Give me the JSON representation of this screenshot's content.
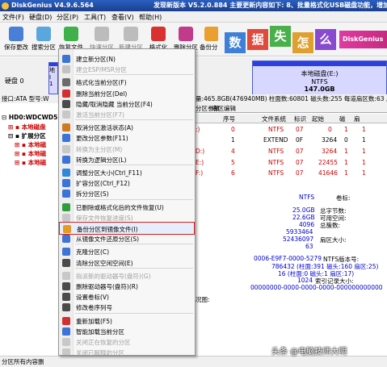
{
  "window": {
    "title": "DiskGenius V4.9.6.564",
    "notice": "发现新版本 V5.2.0.884 主要更新内容如下: 8、批量格式化USB磁盘功能，增加ext4分"
  },
  "menu": [
    "文件(F)",
    "硬盘(D)",
    "分区(P)",
    "工具(T)",
    "查看(V)",
    "帮助(H)"
  ],
  "toolbar": [
    "保存更改",
    "搜索分区",
    "恢复文件",
    "快速分区",
    "新建分区",
    "格式化",
    "删除分区",
    "备份分区"
  ],
  "banner": {
    "chars": [
      "数",
      "据",
      "失",
      "怎",
      "么",
      "办"
    ],
    "brand": "DiskGenius"
  },
  "disk": {
    "label": "硬盘 0",
    "part_name": "本地磁盘(E:)",
    "part_fs": "NTFS",
    "part_size": "147.0GB"
  },
  "left_fragments": [
    "地",
    "I",
    "1"
  ],
  "infobar": {
    "left": "接口:ATA  型号:W",
    "right": "区数:255  每道扇区数:63  总扇"
  },
  "infobar_mid": "量:465.8GB(476940MB)  柱面数:60801  磁头数:255  每道扇区数:63  总扇",
  "tree": {
    "root": "HD0:WDCWD5",
    "items": [
      "本地磁盘",
      "扩展分区",
      "本地磁",
      "本地磁",
      "本地磁"
    ]
  },
  "tabs": [
    "分区参数",
    "浏览文件",
    "扇区编辑"
  ],
  "table": {
    "headers": [
      "序号",
      "文件系统",
      "标识",
      "起始",
      "磁",
      "扇"
    ],
    "rows": [
      [
        "0",
        "NTFS",
        "07",
        "0",
        "1",
        "1"
      ],
      [
        "1",
        "EXTEND",
        "0F",
        "3264",
        "0",
        "1"
      ],
      [
        "4",
        "NTFS",
        "07",
        "3264",
        "1",
        "1"
      ],
      [
        "5",
        "NTFS",
        "07",
        "22455",
        "1",
        "1"
      ],
      [
        "6",
        "NTFS",
        "07",
        "41646",
        "1",
        "1"
      ]
    ],
    "row_suffix": [
      ":)",
      "",
      "D:)",
      "E:)",
      "F:)"
    ]
  },
  "details": {
    "fs": "NTFS",
    "fs_label": "卷标:",
    "values": [
      "25.0GB",
      "22.6GB",
      "4096",
      "5933464",
      "52436097",
      "63"
    ],
    "labels": [
      "总字节数:",
      "可用空间:",
      "总簇数:",
      "扇区大小:",
      ""
    ],
    "extra": [
      "0006-E9F7-0000-5279",
      "786432 (柱面:391 磁头:160 扇区:25)",
      "16 (柱面:0 磁头:1 扇区:17)",
      "1024",
      "00000000-0000-0000-0000-000000000000"
    ],
    "extra_labels": [
      "NTFS版本号:",
      "",
      "",
      "索引记录大小:",
      ""
    ],
    "chart_label": "况图:"
  },
  "context_menu": {
    "items": [
      {
        "label": "建立新分区(N)",
        "enabled": true
      },
      {
        "label": "建立ESP/MSR分区",
        "enabled": false
      },
      {
        "label": "格式化当前分区(F)",
        "enabled": true
      },
      {
        "label": "删除当前分区(Del)",
        "enabled": true
      },
      {
        "label": "隐藏/取消隐藏 当前分区(F4)",
        "enabled": true
      },
      {
        "label": "激活当前分区(F7)",
        "enabled": false
      },
      {
        "label": "取消分区激活状态(A)",
        "enabled": true
      },
      {
        "label": "更改分区参数(F11)",
        "enabled": true
      },
      {
        "label": "转换为主分区(M)",
        "enabled": false
      },
      {
        "label": "转换为逻辑分区(L)",
        "enabled": true
      },
      {
        "label": "调整分区大小(Ctrl_F11)",
        "enabled": true
      },
      {
        "label": "扩容分区(Ctrl_F12)",
        "enabled": true
      },
      {
        "label": "拆分分区(S)",
        "enabled": true
      },
      {
        "label": "已删除或格式化后的文件恢复(U)",
        "enabled": true
      },
      {
        "label": "保存文件恢复进度(S)",
        "enabled": false
      },
      {
        "label": "备份分区到镜像文件(I)",
        "enabled": true,
        "highlighted": true
      },
      {
        "label": "从镜像文件还原分区(S)",
        "enabled": true
      },
      {
        "label": "克隆分区(C)",
        "enabled": true
      },
      {
        "label": "清除分区空闲空间(E)",
        "enabled": true
      },
      {
        "label": "指派新的驱动器号(盘符)(G)",
        "enabled": false
      },
      {
        "label": "删除驱动器号(盘符)(R)",
        "enabled": true
      },
      {
        "label": "设置卷标(V)",
        "enabled": true
      },
      {
        "label": "修改卷序列号",
        "enabled": true
      },
      {
        "label": "重新加载(F5)",
        "enabled": true
      },
      {
        "label": "智能加载当前分区",
        "enabled": true
      },
      {
        "label": "关闭正在恢复的分区",
        "enabled": false
      },
      {
        "label": "关闭已解释的分区",
        "enabled": false
      }
    ]
  },
  "status": "分区所有内容删",
  "watermark": "头条 @电脑技师大明",
  "colors": {
    "title_bar": "#2a5fc2",
    "partition_blue": "#2d3fe0",
    "highlight_border": "#d21e1e",
    "red_text": "#cc0000",
    "brand_pink": "#e03aa0"
  }
}
